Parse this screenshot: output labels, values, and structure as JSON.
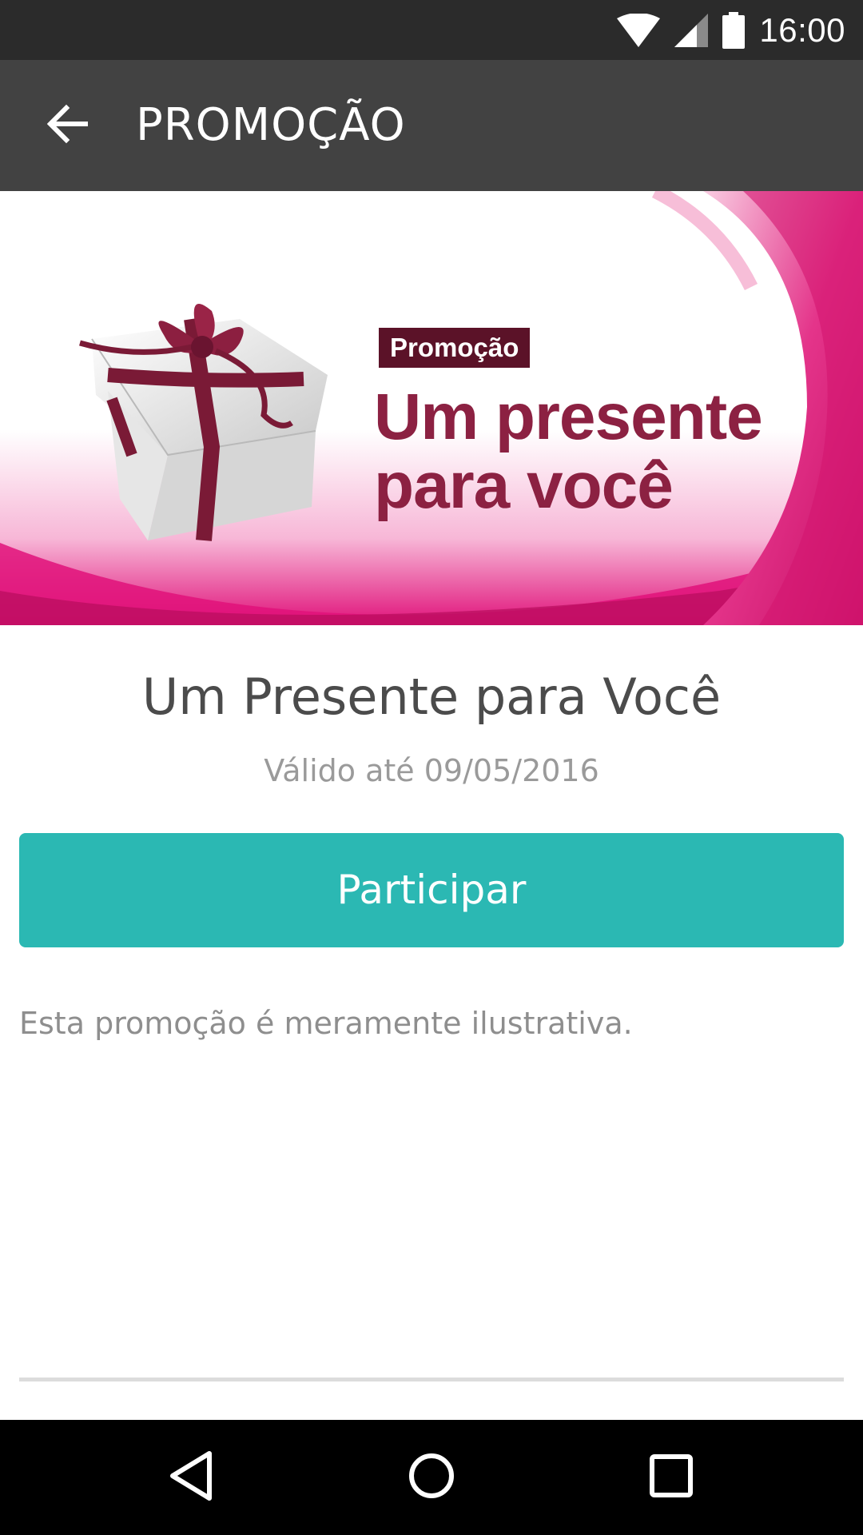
{
  "status_bar": {
    "time": "16:00",
    "icons": [
      "wifi-icon",
      "cell-signal-icon",
      "battery-icon"
    ]
  },
  "app_bar": {
    "title": "PROMOÇÃO",
    "back_icon": "arrow-back-icon"
  },
  "banner": {
    "tag": "Promoção",
    "headline_line1": "Um presente",
    "headline_line2": "para você",
    "image": "gift-box-with-ribbon",
    "colors": {
      "accent": "#e0127a",
      "ribbon": "#7a1a36",
      "tag_bg": "#5b1228",
      "headline": "#8c2142"
    }
  },
  "promotion": {
    "title": "Um Presente para Você",
    "validity": "Válido até 09/05/2016",
    "button_label": "Participar",
    "description": "Esta promoção é meramente ilustrativa."
  },
  "colors": {
    "status_bar": "#2b2b2b",
    "app_bar": "#424242",
    "button": "#2bb8b3"
  },
  "nav_bar": {
    "icons": [
      "back-triangle-icon",
      "home-circle-icon",
      "recents-square-icon"
    ]
  }
}
